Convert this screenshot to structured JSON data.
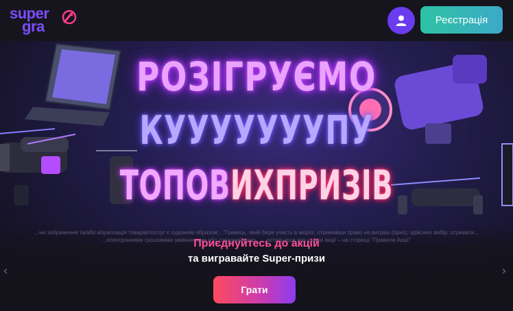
{
  "header": {
    "logo_line1": "super",
    "logo_line2": "gra",
    "register_label": "Реєстрація",
    "avatar_icon": "user-icon"
  },
  "banner": {
    "headline_line1": "РОЗІГРУЄМО",
    "headline_line2": "КУУУУУУУПУ",
    "headline_line3_part1": "ТОПОВ",
    "headline_line3_part2": "ИХ",
    "headline_line3_part3": "ПРИЗІВ",
    "disclaimer_line1": "...чні зображення та/або візуалізація товарів/послуг є художнім образом... \"Гравець, який бере участь в акціях, отримавши право на виграш (приз), здійснює вибір: отримати...",
    "disclaimer_line2": "...електронними грошовими замінниками або товарний приз...                                               ...детальніше про умови акції – на сторінці \"Правила Акції\"",
    "promo_line1": "Приєднуйтесь до акцій",
    "promo_line2": "та вигравайте Super-призи",
    "play_label": "Грати",
    "prev_icon": "chevron-left-icon",
    "next_icon": "chevron-right-icon"
  },
  "colors": {
    "header_bg": "#16151e",
    "brand": "#7b4dff",
    "register_button": "#2dc3a4",
    "play_button_start": "#ff4a5e",
    "play_button_end": "#8c3cf0",
    "promo_accent": "#ff4f9a"
  }
}
